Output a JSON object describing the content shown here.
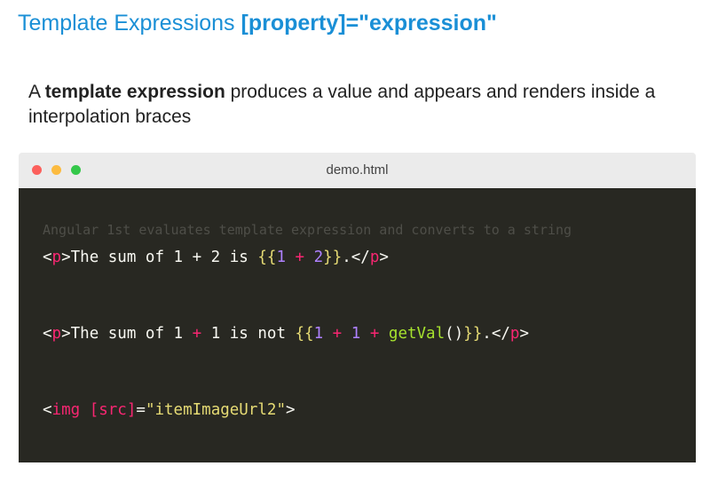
{
  "heading": {
    "prefix": "Template Expressions ",
    "emphasis": "[property]=\"expression\""
  },
  "intro": {
    "lead": "A ",
    "bold": "template expression",
    "rest": " produces a value and appears and renders inside a interpolation braces"
  },
  "window": {
    "filename": "demo.html"
  },
  "code": {
    "comment": "Angular 1st evaluates template expression and converts to a string",
    "line1": {
      "lt": "<",
      "tag": "p",
      "gt_text": ">The sum of 1 + 2 is ",
      "open": "{{",
      "a": "1",
      "plus": " + ",
      "b": "2",
      "close": "}}",
      "tail": ".</",
      "end_tag": "p",
      "end": ">"
    },
    "line2": {
      "lt": "<",
      "tag": "p",
      "gt_text": ">The sum of 1 ",
      "plus_text": "+",
      "mid": " 1 is not ",
      "open": "{{",
      "a": "1",
      "plus1": " + ",
      "b": "1",
      "plus2": " + ",
      "fn": "getVal",
      "parens": "()",
      "close": "}}",
      "tail": ".</",
      "end_tag": "p",
      "end": ">"
    },
    "line3": {
      "lt": "<",
      "tag": "img",
      "sp": " ",
      "attr": "[src]",
      "eq": "=",
      "val": "\"itemImageUrl2\"",
      "end": ">"
    }
  }
}
